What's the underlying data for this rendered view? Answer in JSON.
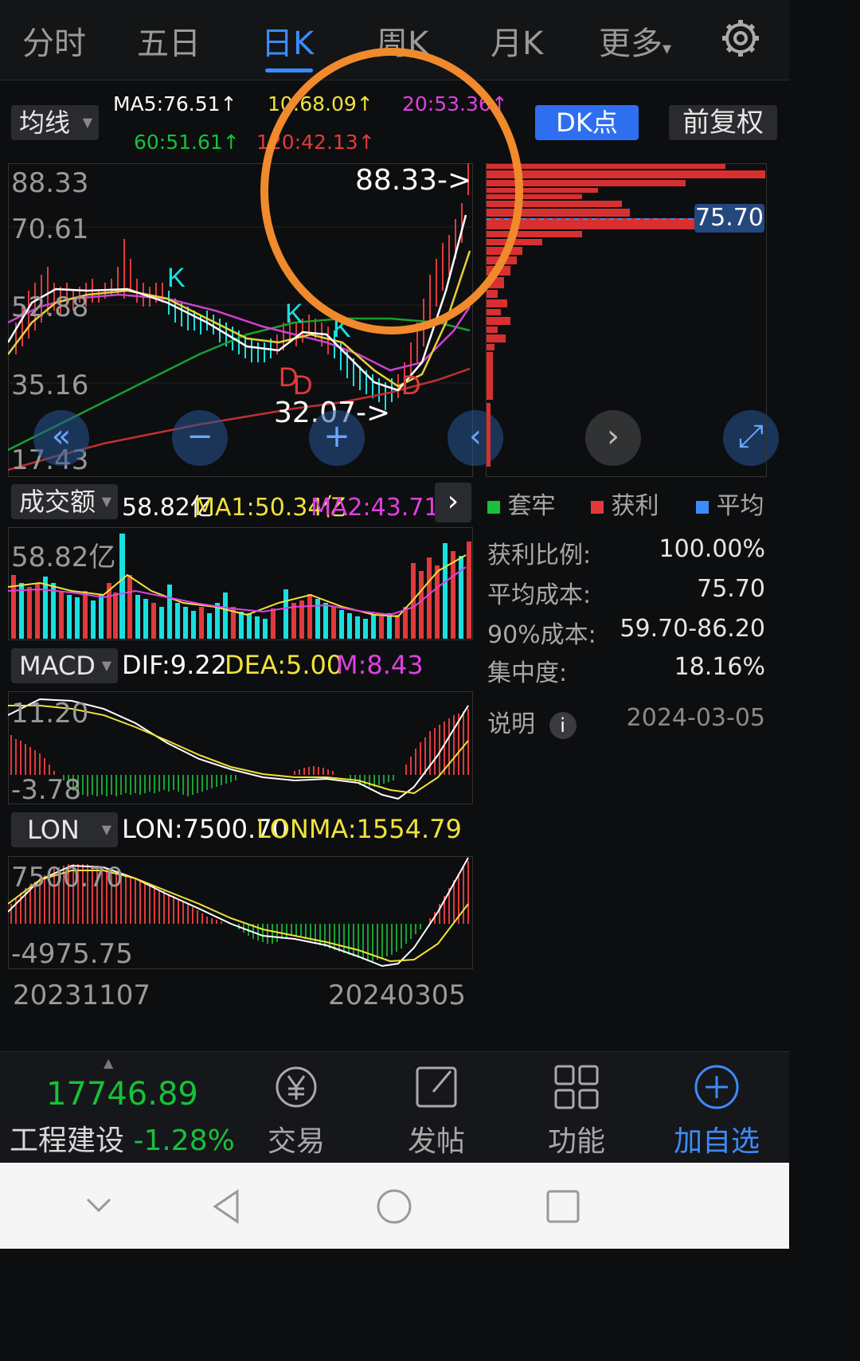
{
  "tabs": [
    "分时",
    "五日",
    "日K",
    "周K",
    "月K",
    "更多"
  ],
  "active_tab": "日K",
  "more_caret": "▾",
  "ma_selector": "均线",
  "ma_values": {
    "ma5": "MA5:76.51↑",
    "ma10": "10:68.09↑",
    "ma20": "20:53.36↑",
    "ma60": "60:51.61↑",
    "ma120": "120:42.13↑"
  },
  "dk_button": "DK点",
  "fq_button": "前复权",
  "price_axis": [
    "88.33",
    "70.61",
    "52.88",
    "35.16",
    "17.43"
  ],
  "high_label": "88.33->",
  "low_label": "32.07->",
  "signals": [
    "K",
    "K",
    "K",
    "D",
    "D",
    "D"
  ],
  "cost_label": "75.70",
  "legend": [
    "套牢",
    "获利",
    "平均"
  ],
  "colors": {
    "up": "#e03a3a",
    "down": "#18e0e0",
    "accent": "#3b8cff",
    "green": "#17c13a",
    "yellow": "#f1e23a",
    "magenta": "#e040e0",
    "orange": "#f08a2c"
  },
  "stats": [
    {
      "label": "获利比例:",
      "value": "100.00%"
    },
    {
      "label": "平均成本:",
      "value": "75.70"
    },
    {
      "label": "90%成本:",
      "value": "59.70-86.20"
    },
    {
      "label": "集中度:",
      "value": "18.16%"
    }
  ],
  "note_label": "说明",
  "note_date": "2024-03-05",
  "volume": {
    "selector": "成交额",
    "value": "58.82亿",
    "ma1": "MA1:50.34亿",
    "ma2": "MA2:43.71亿",
    "axis_top": "58.82亿"
  },
  "macd": {
    "selector": "MACD",
    "dif": "DIF:9.22",
    "dea": "DEA:5.00",
    "m": "M:8.43",
    "axis_top": "11.20",
    "axis_bottom": "-3.78"
  },
  "lon": {
    "selector": "LON",
    "lon": "LON:7500.70",
    "lonma": "LONMA:1554.79",
    "axis_top": "7500.70",
    "axis_bottom": "-4975.75"
  },
  "dates": [
    "20231107",
    "20240305"
  ],
  "bottom": {
    "index_value": "17746.89",
    "index_name": "工程建设",
    "index_change": "-1.28%",
    "trade": "交易",
    "post": "发帖",
    "func": "功能",
    "add": "加自选"
  }
}
